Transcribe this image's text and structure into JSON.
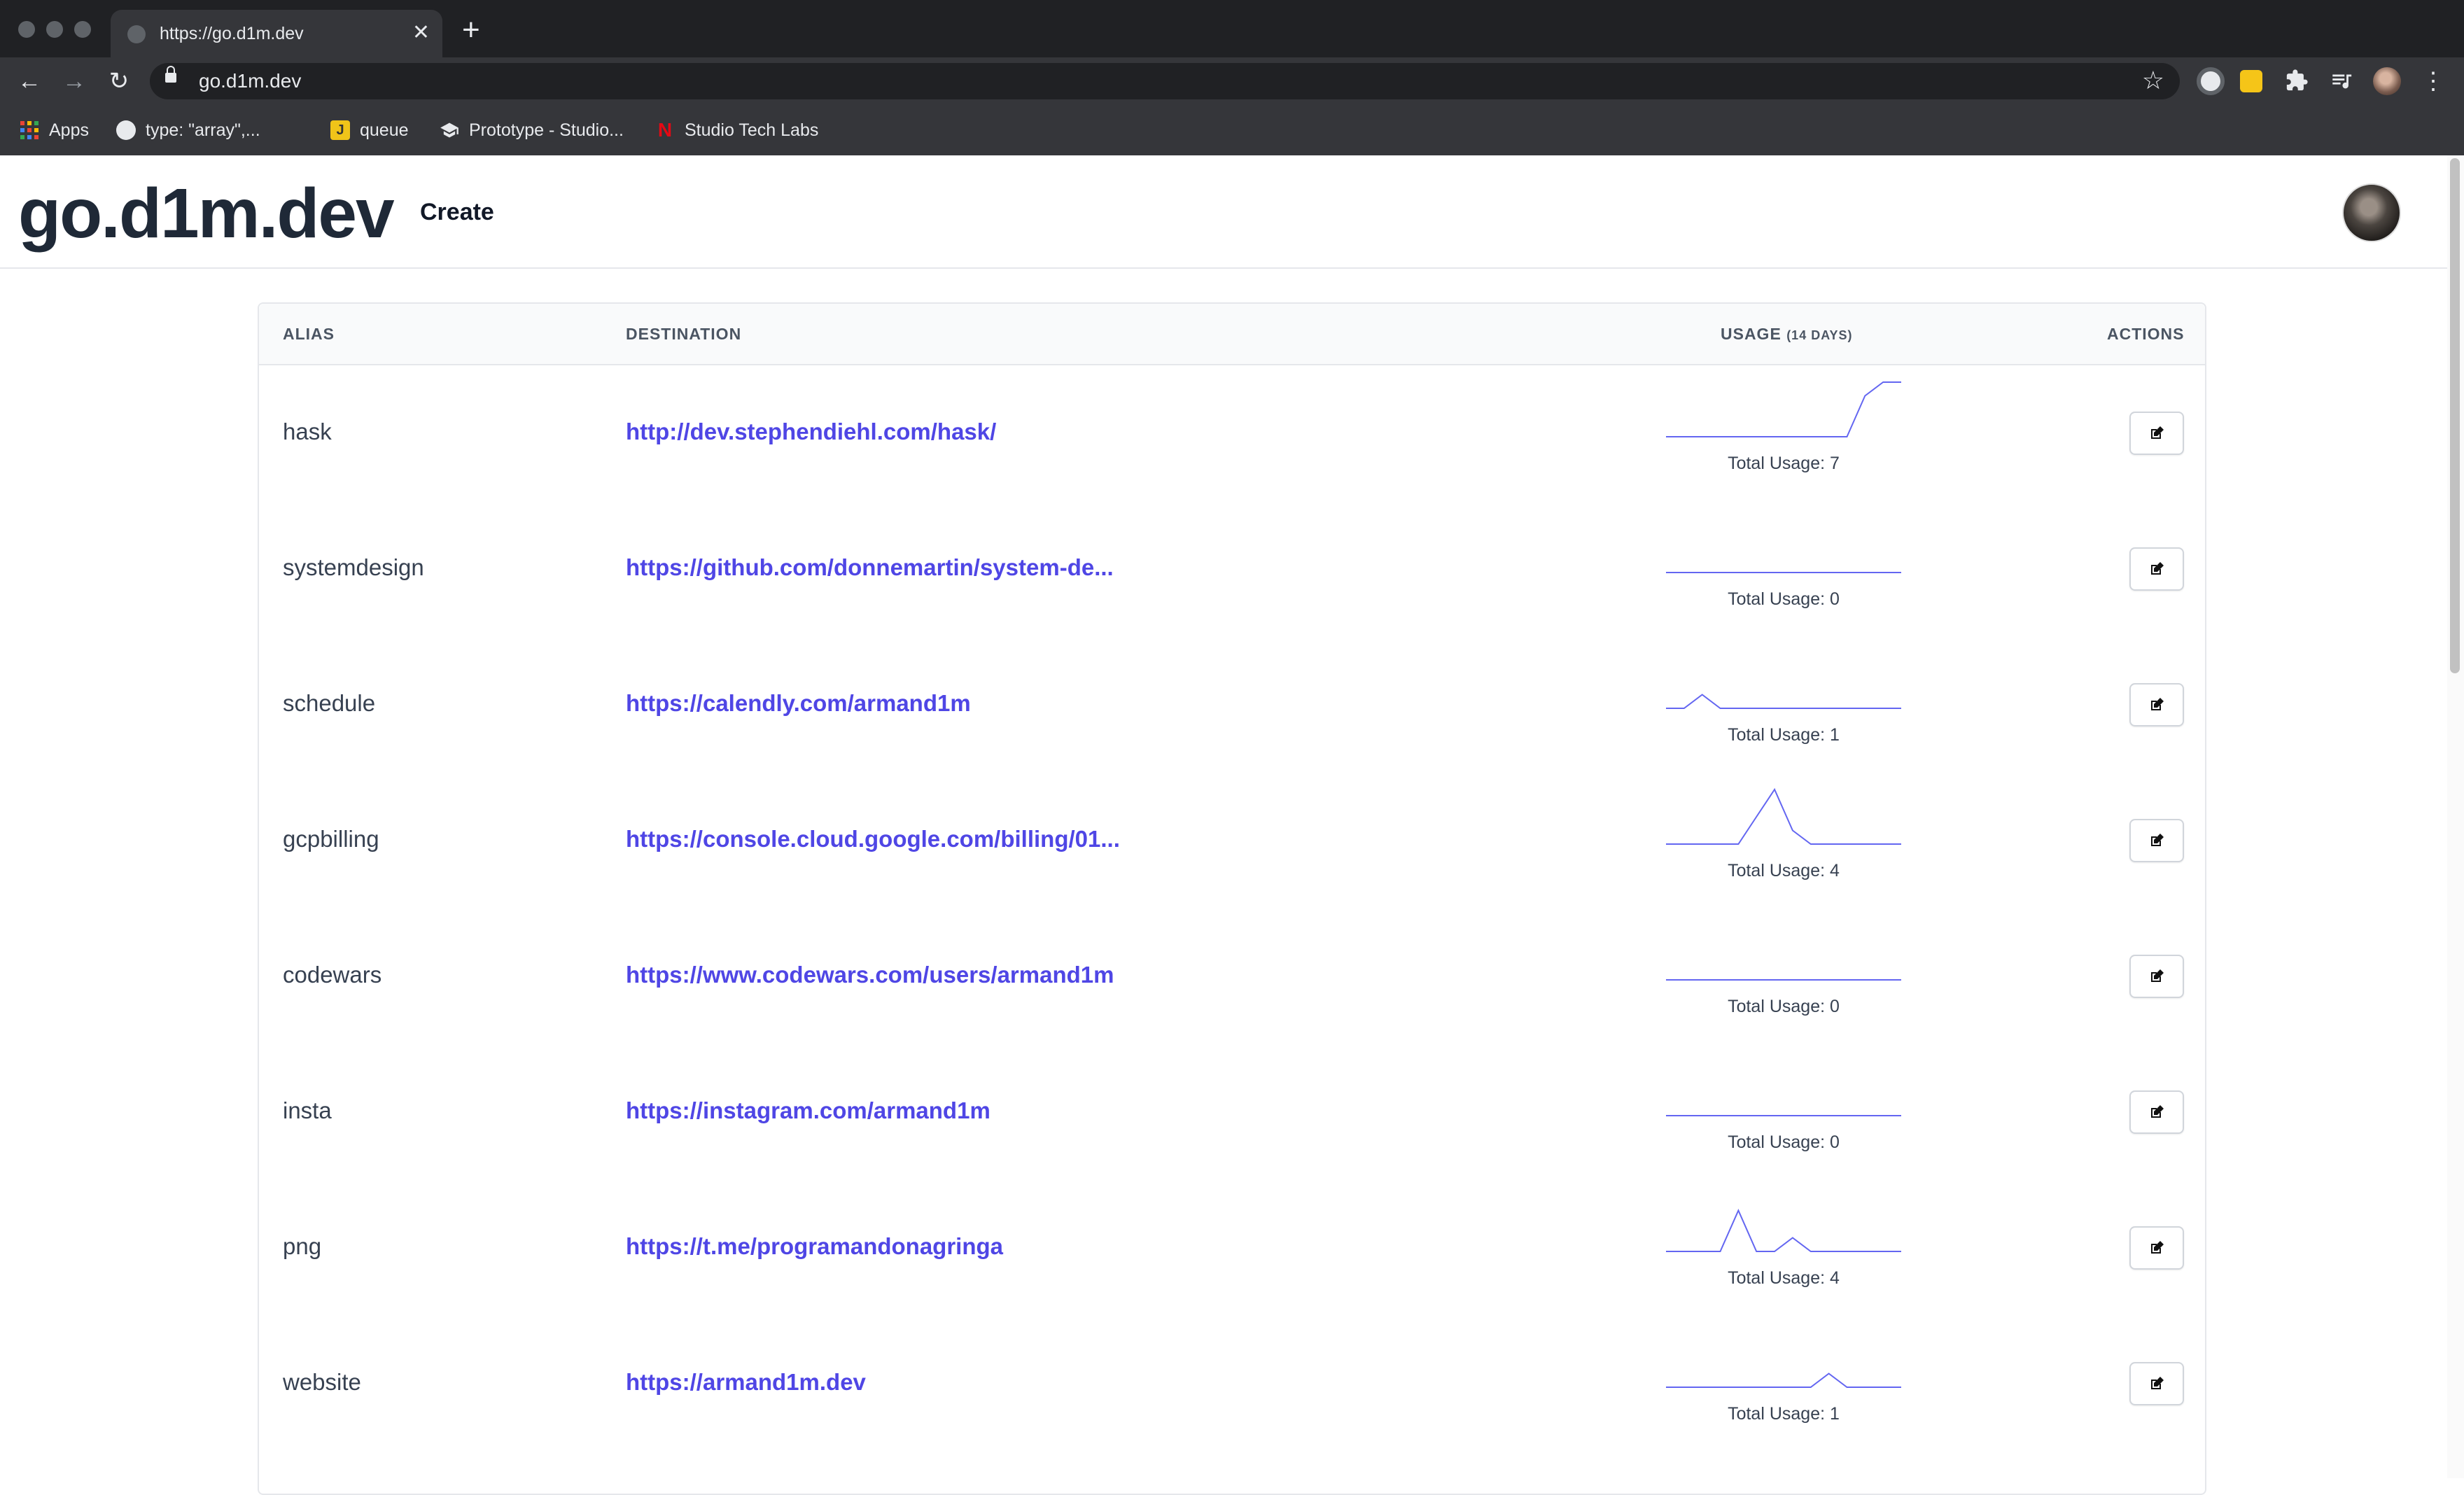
{
  "browser": {
    "tab_title": "https://go.d1m.dev",
    "tab_close": "✕",
    "new_tab": "+",
    "back": "←",
    "forward": "→",
    "reload": "↻",
    "url": "go.d1m.dev",
    "star": "☆",
    "menu": "⋮",
    "bookmarks": [
      {
        "label": "Apps",
        "icon": "apps-grid-icon"
      },
      {
        "label": "type: \"array\",...",
        "icon": "github-icon"
      },
      {
        "label": "queue",
        "icon": "j-icon"
      },
      {
        "label": "Prototype - Studio...",
        "icon": "graduation-cap-icon"
      },
      {
        "label": "Studio Tech Labs",
        "icon": "netflix-icon"
      }
    ]
  },
  "app": {
    "logo": "go.d1m.dev",
    "create_label": "Create"
  },
  "table": {
    "headers": {
      "alias": "ALIAS",
      "destination": "DESTINATION",
      "usage": "USAGE",
      "usage_note": "(14 DAYS)",
      "actions": "ACTIONS"
    },
    "rows": [
      {
        "alias": "hask",
        "destination": "http://dev.stephendiehl.com/hask/",
        "total": "Total Usage: 7",
        "usage": [
          0,
          0,
          0,
          0,
          0,
          0,
          0,
          0,
          0,
          0,
          0,
          3,
          4,
          4
        ]
      },
      {
        "alias": "systemdesign",
        "destination": "https://github.com/donnemartin/system-de...",
        "total": "Total Usage: 0",
        "usage": [
          0,
          0,
          0,
          0,
          0,
          0,
          0,
          0,
          0,
          0,
          0,
          0,
          0,
          0
        ]
      },
      {
        "alias": "schedule",
        "destination": "https://calendly.com/armand1m",
        "total": "Total Usage: 1",
        "usage": [
          0,
          0,
          1,
          0,
          0,
          0,
          0,
          0,
          0,
          0,
          0,
          0,
          0,
          0
        ]
      },
      {
        "alias": "gcpbilling",
        "destination": "https://console.cloud.google.com/billing/01...",
        "total": "Total Usage: 4",
        "usage": [
          0,
          0,
          0,
          0,
          0,
          2,
          4,
          1,
          0,
          0,
          0,
          0,
          0,
          0
        ]
      },
      {
        "alias": "codewars",
        "destination": "https://www.codewars.com/users/armand1m",
        "total": "Total Usage: 0",
        "usage": [
          0,
          0,
          0,
          0,
          0,
          0,
          0,
          0,
          0,
          0,
          0,
          0,
          0,
          0
        ]
      },
      {
        "alias": "insta",
        "destination": "https://instagram.com/armand1m",
        "total": "Total Usage: 0",
        "usage": [
          0,
          0,
          0,
          0,
          0,
          0,
          0,
          0,
          0,
          0,
          0,
          0,
          0,
          0
        ]
      },
      {
        "alias": "png",
        "destination": "https://t.me/programandonagringa",
        "total": "Total Usage: 4",
        "usage": [
          0,
          0,
          0,
          0,
          3,
          0,
          0,
          1,
          0,
          0,
          0,
          0,
          0,
          0
        ]
      },
      {
        "alias": "website",
        "destination": "https://armand1m.dev",
        "total": "Total Usage: 1",
        "usage": [
          0,
          0,
          0,
          0,
          0,
          0,
          0,
          0,
          0,
          1,
          0,
          0,
          0,
          0
        ]
      }
    ]
  },
  "colors": {
    "accent": "#4f46e5",
    "spark_line": "#6366f1"
  }
}
